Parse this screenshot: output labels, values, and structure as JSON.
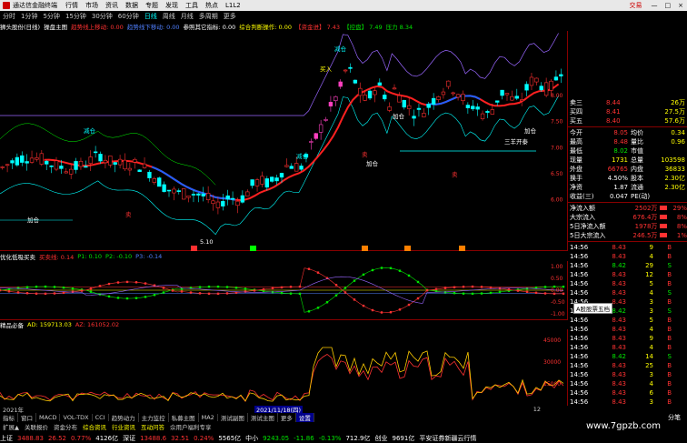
{
  "window": {
    "title": "通达信金融终端",
    "login": "交易",
    "controls": [
      "-",
      "□",
      "×"
    ]
  },
  "menu": [
    "行情",
    "市场",
    "资讯",
    "数据",
    "专题",
    "发现",
    "工具",
    "热点",
    "L1L2"
  ],
  "periods": [
    "分时",
    "1分钟",
    "5分钟",
    "15分钟",
    "30分钟",
    "60分钟",
    "日线",
    "周线",
    "月线",
    "多周期",
    "更多"
  ],
  "chart_header": {
    "symbol": "狮头股份(日线)",
    "items": [
      {
        "text": "操盘主图",
        "color": "#ffffff"
      },
      {
        "text": "趋势线上移动: 0.00",
        "color": "#ff3232"
      },
      {
        "text": "趋势线下移动: 0.00",
        "color": "#5080ff"
      },
      {
        "text": "参照其它指标: 0.00",
        "color": "#ffffff"
      },
      {
        "text": "综合判断操作: 0.00",
        "color": "#ffff00"
      },
      {
        "text": "【资金进】 7.43",
        "color": "#ff3232"
      },
      {
        "text": "【控盘】 7.49",
        "color": "#00e600"
      },
      {
        "text": "压力 8.34",
        "color": "#00e600"
      }
    ]
  },
  "main_axis": [
    "8.00",
    "7.50",
    "7.00",
    "6.50",
    "6.00"
  ],
  "labels": {
    "jiancang": "减仓",
    "jiacang": "加仓",
    "maru": "买入",
    "mai": "卖",
    "sanhuo": "三羊开泰",
    "low": "5.10"
  },
  "osc_header": {
    "name": "优化低吸买卖",
    "items": [
      {
        "text": "买卖线: 0.14",
        "color": "#ff3232"
      },
      {
        "text": "P1: 0.10",
        "color": "#00e600"
      },
      {
        "text": "P2: -0.10",
        "color": "#00e600"
      },
      {
        "text": "P3: -0.14",
        "color": "#5080ff"
      }
    ]
  },
  "osc_axis": [
    "1.00",
    "0.50",
    "0.00",
    "-0.50",
    "-1.00"
  ],
  "vol_header": {
    "name": "精品必备",
    "items": [
      {
        "text": "AD: 159713.03",
        "color": "#ffff00"
      },
      {
        "text": "AZ: 161052.02",
        "color": "#ff3232"
      }
    ]
  },
  "vol_axis": [
    "45000",
    "30000",
    "15000"
  ],
  "right_panel": {
    "quote_rows": [
      {
        "l": "卖三",
        "v": "8.44",
        "c": "#ff3232",
        "q": "26万"
      },
      {
        "l": "买四",
        "v": "8.41",
        "c": "#ff3232",
        "q": "27.5万"
      },
      {
        "l": "买五",
        "v": "8.40",
        "c": "#ff3232",
        "q": "57.6万"
      }
    ],
    "stats": [
      {
        "a": "今开",
        "b": "8.05",
        "bc": "#ff3232",
        "c": "均价",
        "d": "0.34"
      },
      {
        "a": "最高",
        "b": "8.48",
        "bc": "#ff3232",
        "c": "量比",
        "d": "0.96"
      },
      {
        "a": "最低",
        "b": "8.02",
        "bc": "#00e600",
        "c": "市值",
        "d": ""
      },
      {
        "a": "现量",
        "b": "1731",
        "bc": "#ffff00",
        "c": "总量",
        "d": "103598"
      },
      {
        "a": "外盘",
        "b": "66765",
        "bc": "#ff3232",
        "c": "内盘",
        "d": "36833"
      },
      {
        "a": "换手",
        "b": "4.50%",
        "bc": "#ffffff",
        "c": "股本",
        "d": "2.30亿"
      },
      {
        "a": "净资",
        "b": "1.87",
        "bc": "#ffffff",
        "c": "流通",
        "d": "2.30亿"
      },
      {
        "a": "收益(三)",
        "b": "0.047",
        "bc": "#ffffff",
        "c": "PE(动)",
        "d": ""
      }
    ],
    "flow": [
      {
        "l": "净流入额",
        "v": "2502万",
        "p": "29%"
      },
      {
        "l": "大宗流入",
        "v": "676.4万",
        "p": "8%"
      },
      {
        "l": "5日净流入额",
        "v": "1978万",
        "p": "8%"
      },
      {
        "l": "5日大宗流入",
        "v": "246.5万",
        "p": "1%"
      }
    ],
    "ticks": [
      {
        "t": "14:56",
        "p": "8.43",
        "v": "9",
        "d": "B"
      },
      {
        "t": "14:56",
        "p": "8.43",
        "v": "4",
        "d": "B"
      },
      {
        "t": "14:56",
        "p": "8.42",
        "v": "29",
        "d": "S"
      },
      {
        "t": "14:56",
        "p": "8.43",
        "v": "12",
        "d": "B"
      },
      {
        "t": "14:56",
        "p": "8.43",
        "v": "5",
        "d": "B"
      },
      {
        "t": "14:56",
        "p": "8.43",
        "v": "4",
        "d": "S"
      },
      {
        "t": "14:56",
        "p": "8.43",
        "v": "3",
        "d": "B"
      },
      {
        "t": "14:56",
        "p": "8.42",
        "v": "3",
        "d": "S"
      },
      {
        "t": "14:56",
        "p": "8.43",
        "v": "5",
        "d": "B"
      },
      {
        "t": "14:56",
        "p": "8.43",
        "v": "4",
        "d": "B"
      },
      {
        "t": "14:56",
        "p": "8.43",
        "v": "9",
        "d": "B"
      },
      {
        "t": "14:56",
        "p": "8.43",
        "v": "4",
        "d": "B"
      },
      {
        "t": "14:56",
        "p": "8.42",
        "v": "14",
        "d": "S"
      },
      {
        "t": "14:56",
        "p": "8.43",
        "v": "25",
        "d": "B"
      },
      {
        "t": "14:56",
        "p": "8.43",
        "v": "3",
        "d": "B"
      },
      {
        "t": "14:56",
        "p": "8.43",
        "v": "4",
        "d": "B"
      },
      {
        "t": "14:56",
        "p": "8.43",
        "v": "6",
        "d": "B"
      },
      {
        "t": "14:56",
        "p": "8.43",
        "v": "3",
        "d": "B"
      },
      {
        "t": "14:56",
        "p": "8.43",
        "v": "4",
        "d": "B"
      },
      {
        "t": "14:56",
        "p": "8.43",
        "v": "5",
        "d": "B"
      },
      {
        "t": "14:56",
        "p": "8.43",
        "v": "1",
        "d": "B"
      },
      {
        "t": "14:56",
        "p": "8.43",
        "v": "5",
        "d": "B"
      },
      {
        "t": "14:56",
        "p": "8.43",
        "v": "5",
        "d": "B"
      },
      {
        "t": "14:56",
        "p": "8.43",
        "v": "4",
        "d": "B"
      }
    ],
    "tooltip": "A股股票五档"
  },
  "dates": {
    "start": "2021年",
    "mid": "2021/11/18(四)",
    "end": "12"
  },
  "tabs": [
    "指标",
    "窗口",
    "MACD",
    "VOL-TDX",
    "CCI",
    "趋势动力",
    "主力监控",
    "私募主图",
    "MA2",
    "测试副图",
    "测试主图",
    "更多",
    "设置"
  ],
  "tabs2": [
    "扩展▲",
    "关联报价",
    "资金分布",
    "综合资讯",
    "行业资讯",
    "互动问答",
    "佘用户福利专享"
  ],
  "status": [
    {
      "text": "上证",
      "color": "#ffffff"
    },
    {
      "text": "3488.83",
      "color": "#ff3232"
    },
    {
      "text": "26.52",
      "color": "#ff3232"
    },
    {
      "text": "0.77%",
      "color": "#ff3232"
    },
    {
      "text": "4126亿",
      "color": "#ffffff"
    },
    {
      "text": "深证",
      "color": "#ffffff"
    },
    {
      "text": "13488.6",
      "color": "#ff3232"
    },
    {
      "text": "32.51",
      "color": "#ff3232"
    },
    {
      "text": "0.24%",
      "color": "#ff3232"
    },
    {
      "text": "5565亿",
      "color": "#ffffff"
    },
    {
      "text": "中小",
      "color": "#ffffff"
    },
    {
      "text": "9243.05",
      "color": "#00e600"
    },
    {
      "text": "-11.86",
      "color": "#00e600"
    },
    {
      "text": "-0.13%",
      "color": "#00e600"
    },
    {
      "text": "712.9亿",
      "color": "#ffffff"
    },
    {
      "text": "创业",
      "color": "#ffffff"
    },
    {
      "text": "9691亿",
      "color": "#ffffff"
    },
    {
      "text": "平安证券新疆云行情",
      "color": "#ffffff"
    }
  ],
  "right_bottom": "分笔",
  "watermark": "www.7gpzb.com"
}
